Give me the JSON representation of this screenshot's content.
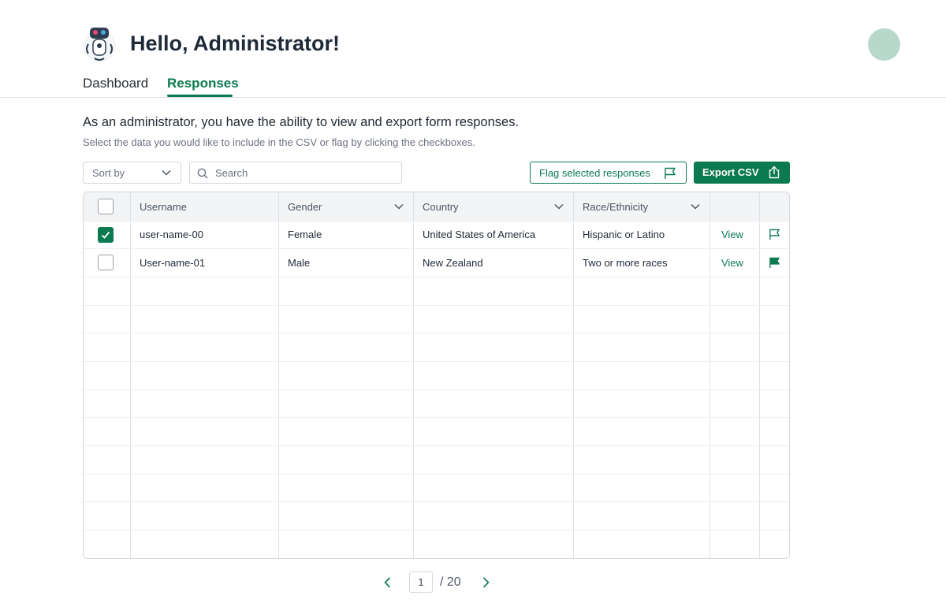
{
  "header": {
    "greeting": "Hello, Administrator!",
    "tabs": [
      {
        "label": "Dashboard",
        "active": false
      },
      {
        "label": "Responses",
        "active": true
      }
    ]
  },
  "intro": {
    "title": "As an administrator, you have the ability to view and export form responses.",
    "subtitle": "Select the data you would like to include in the CSV or flag by clicking the checkboxes."
  },
  "toolbar": {
    "sort_label": "Sort by",
    "search_placeholder": "Search",
    "search_value": "",
    "flag_button_label": "Flag selected responses",
    "export_button_label": "Export CSV"
  },
  "table": {
    "columns": [
      "Username",
      "Gender",
      "Country",
      "Race/Ethnicity"
    ],
    "rows": [
      {
        "selected": true,
        "username": "user-name-00",
        "gender": "Female",
        "country": "United States of America",
        "race": "Hispanic or Latino",
        "action": "View",
        "flagged": false
      },
      {
        "selected": false,
        "username": "User-name-01",
        "gender": "Male",
        "country": "New Zealand",
        "race": "Two or more races",
        "action": "View",
        "flagged": true
      }
    ]
  },
  "pagination": {
    "current_page": "1",
    "total_label": "/ 20"
  },
  "colors": {
    "accent": "#0b7a50",
    "avatar": "#b7d8cb"
  }
}
